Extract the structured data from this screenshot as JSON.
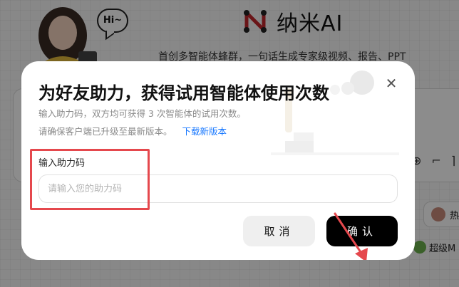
{
  "background": {
    "speech_bubble": "Hi~",
    "brand_name": "纳米AI",
    "tagline": "首创多智能体蜂群，一句话生成专家级视频、报告、PPT",
    "chip1_label": "热",
    "chip2_label": "超级M",
    "icons": [
      "avatar",
      "brand-logo-icon",
      "add-circle-icon",
      "crop-icon",
      "bracket-icon"
    ]
  },
  "dialog": {
    "title": "为好友助力，获得试用智能体使用次数",
    "description": "输入助力码，双方均可获得 3 次智能体的试用次数。",
    "version_hint": "请确保客户端已升级至最新版本。",
    "download_link": "下载新版本",
    "field_label": "输入助力码",
    "input_value": "",
    "input_placeholder": "请输入您的助力码",
    "cancel_label": "取消",
    "confirm_label": "确认",
    "close_icon": "close-icon"
  },
  "colors": {
    "link": "#1677ff",
    "highlight_box": "#e5484d",
    "confirm_button": "#000000",
    "cancel_button": "#efefef",
    "brand_logo": "#c1272d"
  }
}
